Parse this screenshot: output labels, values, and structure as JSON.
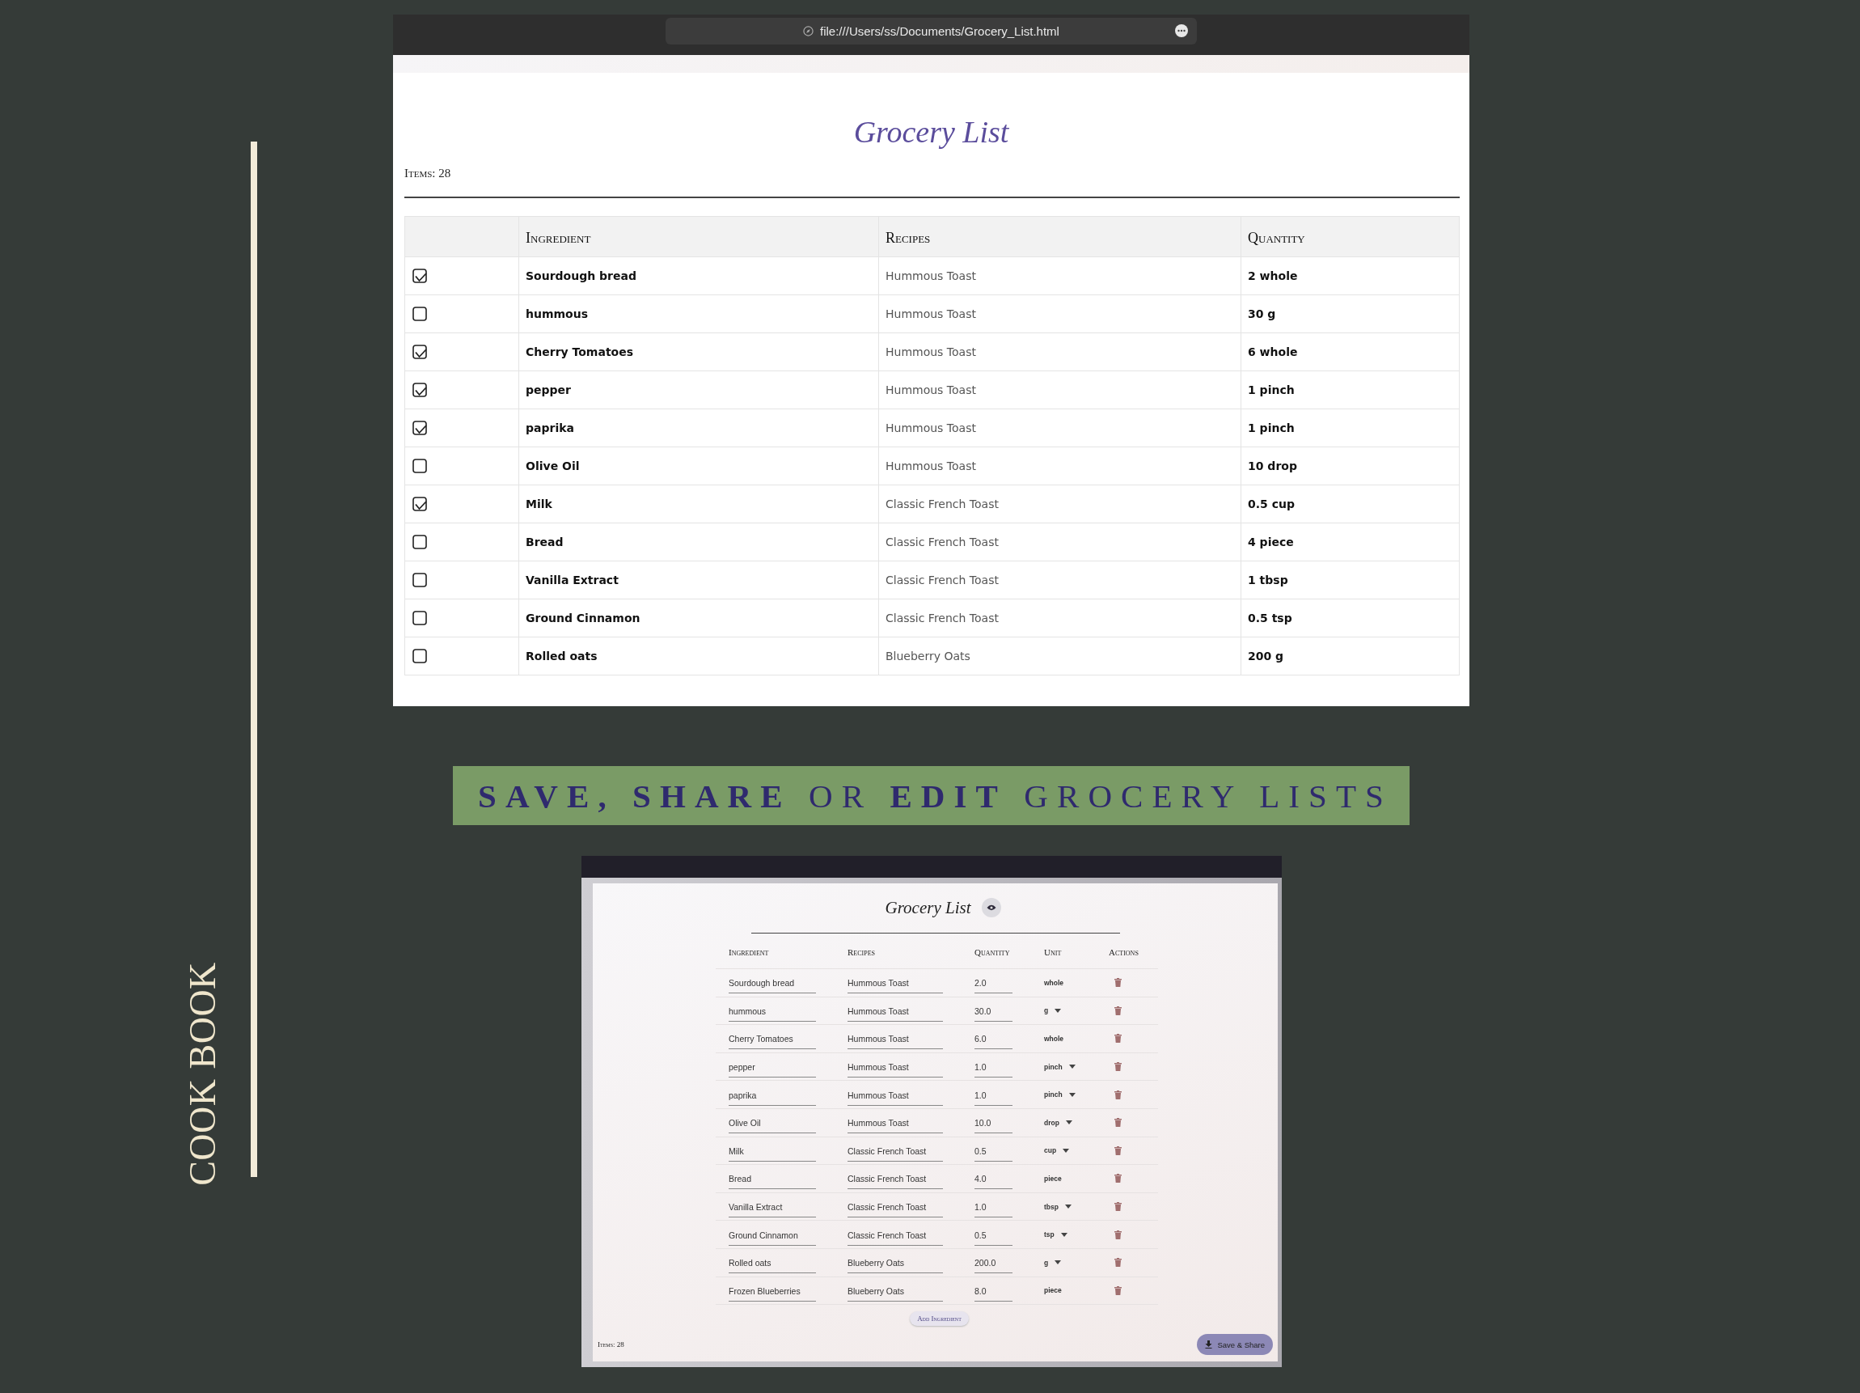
{
  "side_title": "COOK BOOK",
  "browser": {
    "url": "file:///Users/ss/Documents/Grocery_List.html",
    "page": {
      "title": "Grocery List",
      "items_count": "Items: 28",
      "table": {
        "columns": [
          "Ingredient",
          "Recipes",
          "Quantity"
        ],
        "rows": [
          {
            "checked": true,
            "ingredient": "Sourdough bread",
            "recipe": "Hummous Toast",
            "quantity": "2 whole"
          },
          {
            "checked": false,
            "ingredient": "hummous",
            "recipe": "Hummous Toast",
            "quantity": "30 g"
          },
          {
            "checked": true,
            "ingredient": "Cherry Tomatoes",
            "recipe": "Hummous Toast",
            "quantity": "6 whole"
          },
          {
            "checked": true,
            "ingredient": "pepper",
            "recipe": "Hummous Toast",
            "quantity": "1 pinch"
          },
          {
            "checked": true,
            "ingredient": "paprika",
            "recipe": "Hummous Toast",
            "quantity": "1 pinch"
          },
          {
            "checked": false,
            "ingredient": "Olive Oil",
            "recipe": "Hummous Toast",
            "quantity": "10 drop"
          },
          {
            "checked": true,
            "ingredient": "Milk",
            "recipe": "Classic French Toast",
            "quantity": "0.5 cup"
          },
          {
            "checked": false,
            "ingredient": "Bread",
            "recipe": "Classic French Toast",
            "quantity": "4 piece"
          },
          {
            "checked": false,
            "ingredient": "Vanilla Extract",
            "recipe": "Classic French Toast",
            "quantity": "1 tbsp"
          },
          {
            "checked": false,
            "ingredient": "Ground Cinnamon",
            "recipe": "Classic French Toast",
            "quantity": "0.5 tsp"
          },
          {
            "checked": false,
            "ingredient": "Rolled oats",
            "recipe": "Blueberry Oats",
            "quantity": "200 g"
          }
        ]
      }
    }
  },
  "banner": "**SAVE, SHARE** OR **EDIT** GROCERY LISTS",
  "editor": {
    "title": "Grocery List",
    "table": {
      "columns": [
        "Ingredient",
        "Recipes",
        "Quantity",
        "Unit",
        "Actions"
      ],
      "rows": [
        {
          "ingredient": "Sourdough bread",
          "recipe": "Hummous Toast",
          "quantity": "2.0",
          "unit": "whole",
          "dropdown": false
        },
        {
          "ingredient": "hummous",
          "recipe": "Hummous Toast",
          "quantity": "30.0",
          "unit": "g",
          "dropdown": true
        },
        {
          "ingredient": "Cherry Tomatoes",
          "recipe": "Hummous Toast",
          "quantity": "6.0",
          "unit": "whole",
          "dropdown": false
        },
        {
          "ingredient": "pepper",
          "recipe": "Hummous Toast",
          "quantity": "1.0",
          "unit": "pinch",
          "dropdown": true
        },
        {
          "ingredient": "paprika",
          "recipe": "Hummous Toast",
          "quantity": "1.0",
          "unit": "pinch",
          "dropdown": true
        },
        {
          "ingredient": "Olive Oil",
          "recipe": "Hummous Toast",
          "quantity": "10.0",
          "unit": "drop",
          "dropdown": true
        },
        {
          "ingredient": "Milk",
          "recipe": "Classic French Toast",
          "quantity": "0.5",
          "unit": "cup",
          "dropdown": true
        },
        {
          "ingredient": "Bread",
          "recipe": "Classic French Toast",
          "quantity": "4.0",
          "unit": "piece",
          "dropdown": false
        },
        {
          "ingredient": "Vanilla Extract",
          "recipe": "Classic French Toast",
          "quantity": "1.0",
          "unit": "tbsp",
          "dropdown": true
        },
        {
          "ingredient": "Ground Cinnamon",
          "recipe": "Classic French Toast",
          "quantity": "0.5",
          "unit": "tsp",
          "dropdown": true
        },
        {
          "ingredient": "Rolled oats",
          "recipe": "Blueberry Oats",
          "quantity": "200.0",
          "unit": "g",
          "dropdown": true
        },
        {
          "ingredient": "Frozen Blueberries",
          "recipe": "Blueberry Oats",
          "quantity": "8.0",
          "unit": "piece",
          "dropdown": false
        }
      ]
    },
    "add_button": "Add Ingredient",
    "items_count": "Items: 28",
    "save_button": "Save & Share"
  }
}
